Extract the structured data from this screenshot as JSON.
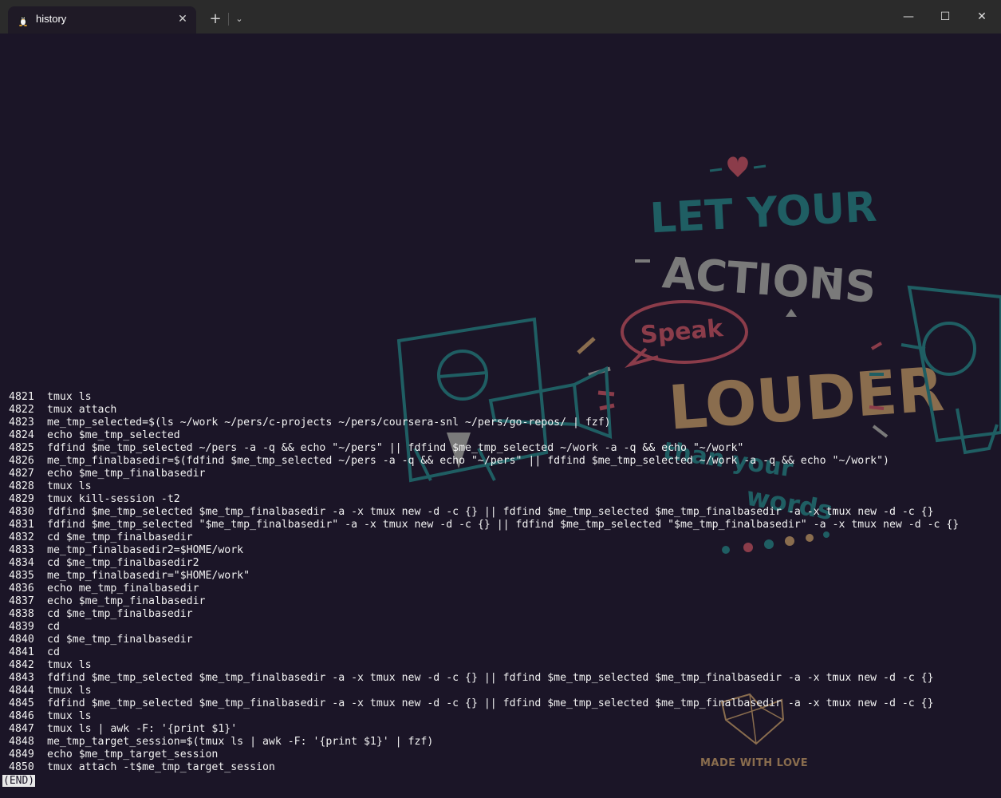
{
  "window": {
    "tab_title": "history",
    "tab_icon": "linux-penguin-icon",
    "close_tab": "✕",
    "new_tab": "+",
    "dropdown": "⌄",
    "minimize": "—",
    "maximize": "☐",
    "close": "✕"
  },
  "colors": {
    "terminal_bg": "#1b1527",
    "titlebar_bg": "#2b2b2b",
    "text": "#f2f2f2",
    "wallpaper_teal": "#1f5e63",
    "wallpaper_brown": "#8a6d4e",
    "wallpaper_red": "#8b3c4a"
  },
  "history": [
    {
      "num": "4821",
      "cmd": "tmux ls"
    },
    {
      "num": "4822",
      "cmd": "tmux attach"
    },
    {
      "num": "4823",
      "cmd": "me_tmp_selected=$(ls ~/work ~/pers/c-projects ~/pers/coursera-snl ~/pers/go-repos/ | fzf)"
    },
    {
      "num": "4824",
      "cmd": "echo $me_tmp_selected"
    },
    {
      "num": "4825",
      "cmd": "fdfind $me_tmp_selected ~/pers -a -q && echo \"~/pers\" || fdfind $me_tmp_selected ~/work -a -q && echo \"~/work\""
    },
    {
      "num": "4826",
      "cmd": "me_tmp_finalbasedir=$(fdfind $me_tmp_selected ~/pers -a -q && echo \"~/pers\" || fdfind $me_tmp_selected ~/work -a -q && echo \"~/work\")"
    },
    {
      "num": "4827",
      "cmd": "echo $me_tmp_finalbasedir"
    },
    {
      "num": "4828",
      "cmd": "tmux ls"
    },
    {
      "num": "4829",
      "cmd": "tmux kill-session -t2"
    },
    {
      "num": "4830",
      "cmd": "fdfind $me_tmp_selected $me_tmp_finalbasedir -a -x tmux new -d -c {} || fdfind $me_tmp_selected $me_tmp_finalbasedir -a -x tmux new -d -c {}"
    },
    {
      "num": "4831",
      "cmd": "fdfind $me_tmp_selected \"$me_tmp_finalbasedir\" -a -x tmux new -d -c {} || fdfind $me_tmp_selected \"$me_tmp_finalbasedir\" -a -x tmux new -d -c {}"
    },
    {
      "num": "4832",
      "cmd": "cd $me_tmp_finalbasedir"
    },
    {
      "num": "4833",
      "cmd": "me_tmp_finalbasedir2=$HOME/work"
    },
    {
      "num": "4834",
      "cmd": "cd $me_tmp_finalbasedir2"
    },
    {
      "num": "4835",
      "cmd": "me_tmp_finalbasedir=\"$HOME/work\""
    },
    {
      "num": "4836",
      "cmd": "echo me_tmp_finalbasedir"
    },
    {
      "num": "4837",
      "cmd": "echo $me_tmp_finalbasedir"
    },
    {
      "num": "4838",
      "cmd": "cd $me_tmp_finalbasedir"
    },
    {
      "num": "4839",
      "cmd": "cd"
    },
    {
      "num": "4840",
      "cmd": "cd $me_tmp_finalbasedir"
    },
    {
      "num": "4841",
      "cmd": "cd"
    },
    {
      "num": "4842",
      "cmd": "tmux ls"
    },
    {
      "num": "4843",
      "cmd": "fdfind $me_tmp_selected $me_tmp_finalbasedir -a -x tmux new -d -c {} || fdfind $me_tmp_selected $me_tmp_finalbasedir -a -x tmux new -d -c {}"
    },
    {
      "num": "4844",
      "cmd": "tmux ls"
    },
    {
      "num": "4845",
      "cmd": "fdfind $me_tmp_selected $me_tmp_finalbasedir -a -x tmux new -d -c {} || fdfind $me_tmp_selected $me_tmp_finalbasedir -a -x tmux new -d -c {}"
    },
    {
      "num": "4846",
      "cmd": "tmux ls"
    },
    {
      "num": "4847",
      "cmd": "tmux ls | awk -F: '{print $1}'"
    },
    {
      "num": "4848",
      "cmd": "me_tmp_target_session=$(tmux ls | awk -F: '{print $1}' | fzf)"
    },
    {
      "num": "4849",
      "cmd": "echo $me_tmp_target_session"
    },
    {
      "num": "4850",
      "cmd": "tmux attach -t$me_tmp_target_session"
    }
  ],
  "pager_status": "(END)",
  "wallpaper": {
    "line1": "LET YOUR",
    "line2": "ACTIONS",
    "line3": "Speak",
    "line4": "LOUDER",
    "line5": "than your",
    "line6": "words",
    "badge": "MADE WITH LOVE"
  }
}
